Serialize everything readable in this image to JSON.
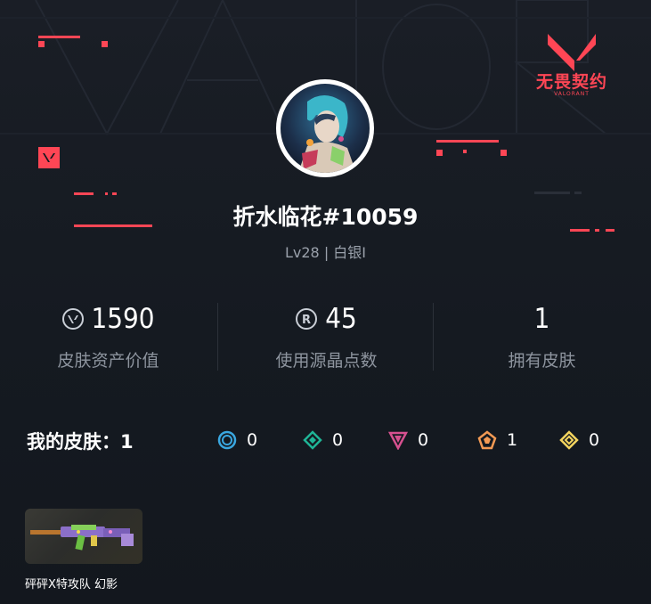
{
  "brand": {
    "logo_icon": "valorant-v-logo",
    "name_cn": "无畏契约",
    "name_en": "VALORANT",
    "accent": "#ff4655"
  },
  "profile": {
    "avatar": "player-avatar-image",
    "name": "折水临花#10059",
    "level": "Lv28 | 白银I"
  },
  "stats": [
    {
      "icon": "valorant-points-icon",
      "value": "1590",
      "label": "皮肤资产价值"
    },
    {
      "icon": "radianite-points-icon",
      "value": "45",
      "label": "使用源晶点数"
    },
    {
      "icon": "",
      "value": "1",
      "label": "拥有皮肤"
    }
  ],
  "skins_summary": {
    "title": "我的皮肤：1",
    "tiers": [
      {
        "icon": "select-tier-icon",
        "color": "#3aa7e0",
        "count": "0"
      },
      {
        "icon": "deluxe-tier-icon",
        "color": "#1fb496",
        "count": "0"
      },
      {
        "icon": "premium-tier-icon",
        "color": "#d6508f",
        "count": "0"
      },
      {
        "icon": "exclusive-tier-icon",
        "color": "#f39a54",
        "count": "1"
      },
      {
        "icon": "ultra-tier-icon",
        "color": "#f4d45e",
        "count": "0"
      }
    ]
  },
  "skins": [
    {
      "name": "砰砰X特攻队 幻影",
      "image": "phantom-weapon-skin"
    }
  ]
}
